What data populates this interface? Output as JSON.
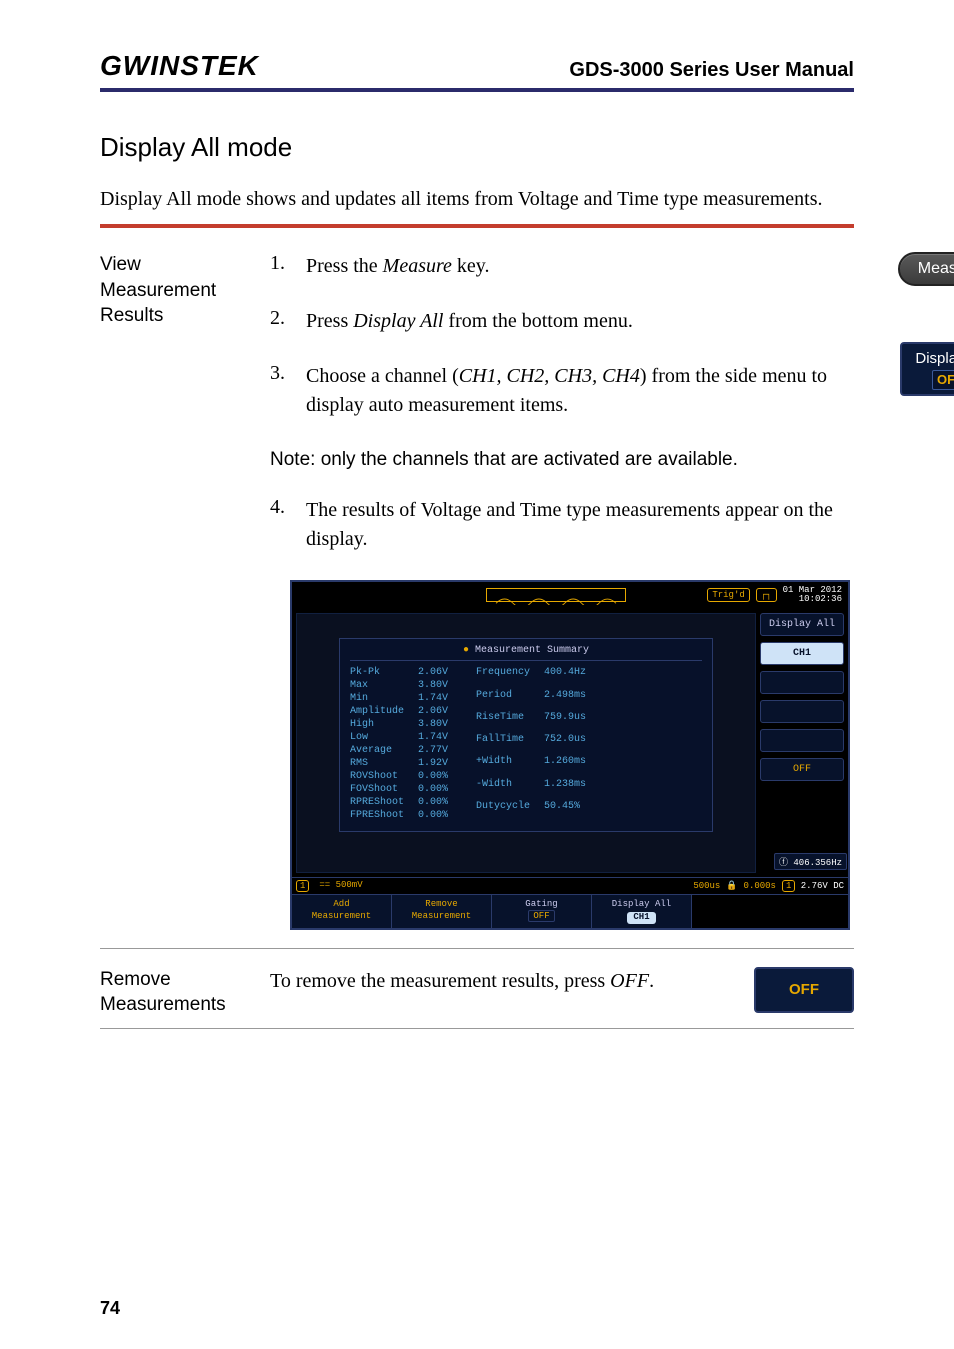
{
  "header": {
    "brand": "GWINSTEK",
    "manual_title": "GDS-3000 Series User Manual"
  },
  "section_title": "Display All mode",
  "intro": "Display All mode shows and updates all items from Voltage and Time type measurements.",
  "left_labels": {
    "view": "View Measurement Results",
    "remove": "Remove Measurements"
  },
  "steps": {
    "s1_num": "1.",
    "s1_text_a": "Press the ",
    "s1_text_key": "Measure",
    "s1_text_b": " key.",
    "s2_num": "2.",
    "s2_text_a": "Press ",
    "s2_text_key": "Display All",
    "s2_text_b": " from the bottom menu.",
    "s3_num": "3.",
    "s3_text_a": "Choose a channel (",
    "s3_text_key": "CH1, CH2, CH3, CH4",
    "s3_text_b": ") from the side menu to display auto measurement items.",
    "note": "Note: only the channels that are activated are available.",
    "s4_num": "4.",
    "s4_text": "The results of Voltage and Time type measurements appear on the display."
  },
  "keys": {
    "measure": "Measure",
    "display_all_label": "Display All",
    "display_all_off": "OFF",
    "off": "OFF"
  },
  "scope": {
    "trig": "Trig'd",
    "timestamp_line1": "01 Mar 2012",
    "timestamp_line2": "10:02:36",
    "side": {
      "display_all": "Display All",
      "ch1": "CH1",
      "off": "OFF"
    },
    "measurement_summary_title": "Measurement Summary",
    "left_col": [
      [
        "Pk-Pk",
        "2.06V"
      ],
      [
        "Max",
        "3.80V"
      ],
      [
        "Min",
        "1.74V"
      ],
      [
        "Amplitude",
        "2.06V"
      ],
      [
        "High",
        "3.80V"
      ],
      [
        "Low",
        "1.74V"
      ],
      [
        "Average",
        "2.77V"
      ],
      [
        "RMS",
        "1.92V"
      ],
      [
        "ROVShoot",
        "0.00%"
      ],
      [
        "FOVShoot",
        "0.00%"
      ],
      [
        "RPREShoot",
        "0.00%"
      ],
      [
        "FPREShoot",
        "0.00%"
      ]
    ],
    "right_col": [
      [
        "Frequency",
        "400.4Hz"
      ],
      [
        "Period",
        "2.498ms"
      ],
      [
        "RiseTime",
        "759.9us"
      ],
      [
        "FallTime",
        "752.0us"
      ],
      [
        "+Width",
        "1.260ms"
      ],
      [
        "-Width",
        "1.238ms"
      ],
      [
        "Dutycycle",
        "50.45%"
      ]
    ],
    "bottom_bar": {
      "ch_readout": "== 500mV",
      "time_readout": "500us",
      "delay_readout": "0.000s",
      "freq": "406.356Hz",
      "trig_readout": "2.76V",
      "coupling": "DC"
    },
    "bottom_menu": {
      "add_l1": "Add",
      "add_l2": "Measurement",
      "remove_l1": "Remove",
      "remove_l2": "Measurement",
      "gating_l1": "Gating",
      "gating_l2": "OFF",
      "display_l1": "Display All",
      "display_l2": "CH1"
    }
  },
  "remove": {
    "text_a": "To remove the measurement results, press ",
    "text_key": "OFF",
    "text_b": "."
  },
  "page_number": "74"
}
